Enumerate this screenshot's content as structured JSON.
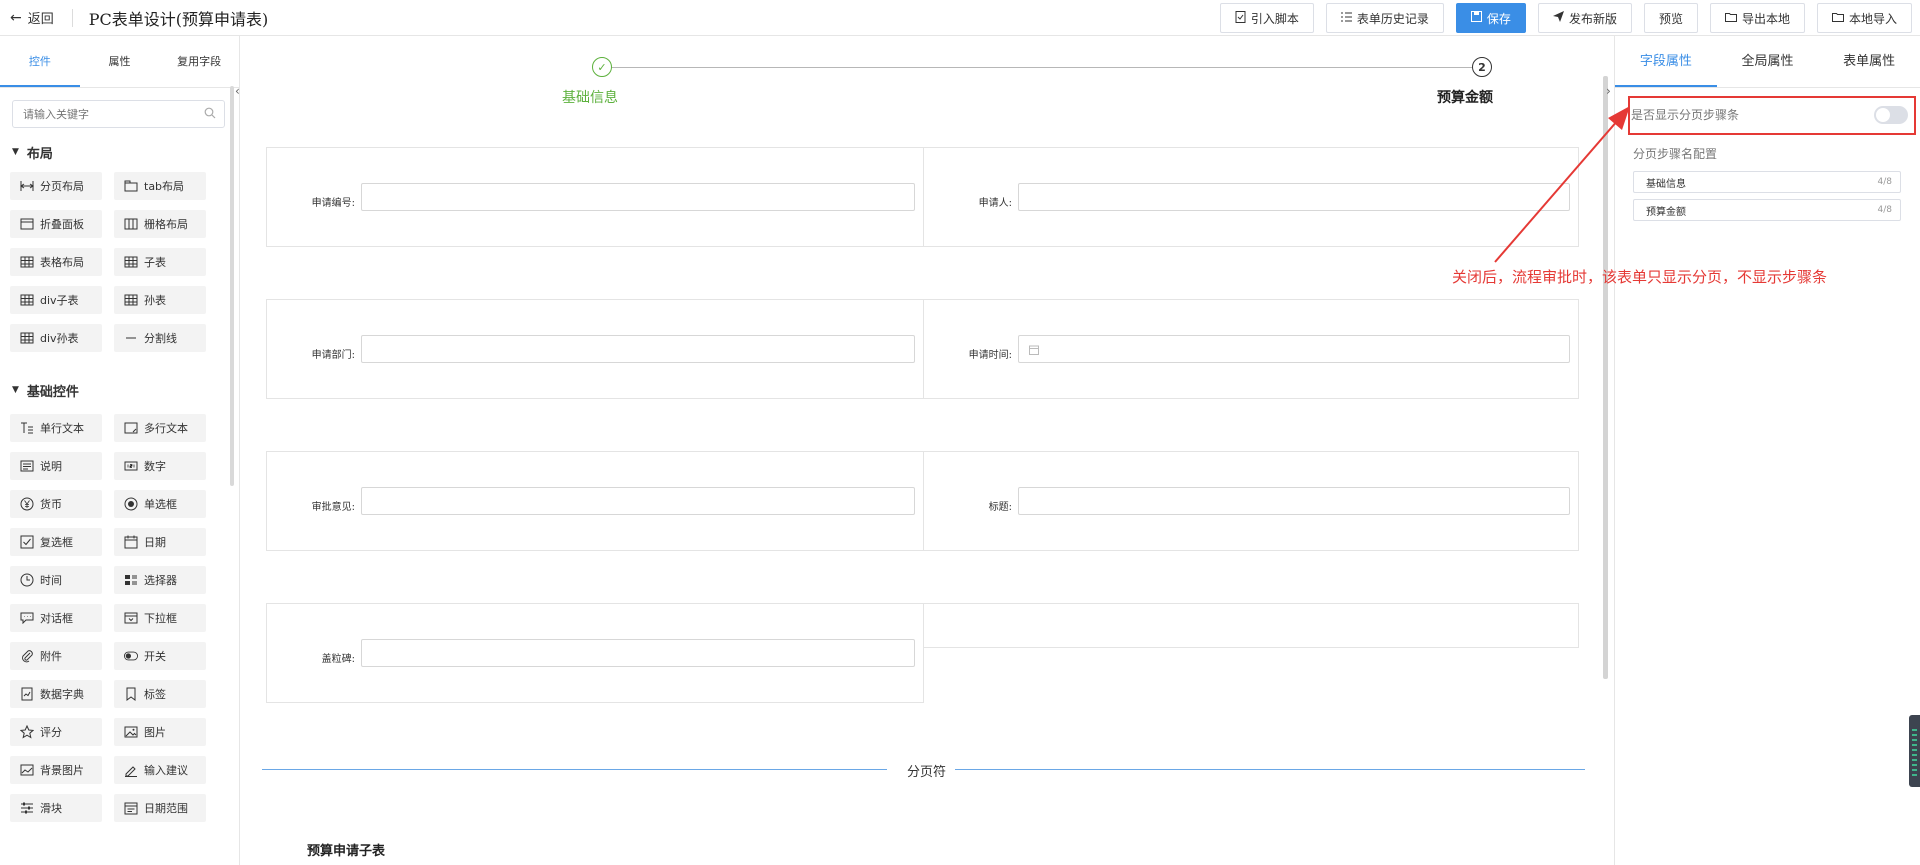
{
  "header": {
    "back_label": "返回",
    "title": "PC表单设计(预算申请表)",
    "buttons": {
      "import_script": "引入脚本",
      "history": "表单历史记录",
      "save": "保存",
      "publish": "发布新版",
      "preview": "预览",
      "export": "导出本地",
      "import_local": "本地导入"
    }
  },
  "left_panel": {
    "tabs": [
      "控件",
      "属性",
      "复用字段"
    ],
    "search_placeholder": "请输入关键字",
    "groups": [
      {
        "title": "布局",
        "items": [
          {
            "label": "分页布局",
            "icon": "page-layout-icon"
          },
          {
            "label": "tab布局",
            "icon": "tab-layout-icon"
          },
          {
            "label": "折叠面板",
            "icon": "collapse-panel-icon"
          },
          {
            "label": "栅格布局",
            "icon": "grid-layout-icon"
          },
          {
            "label": "表格布局",
            "icon": "table-layout-icon"
          },
          {
            "label": "子表",
            "icon": "subtable-icon"
          },
          {
            "label": "div子表",
            "icon": "div-subtable-icon"
          },
          {
            "label": "孙表",
            "icon": "grandchild-table-icon"
          },
          {
            "label": "div孙表",
            "icon": "div-grandchild-table-icon"
          },
          {
            "label": "分割线",
            "icon": "divider-icon"
          }
        ]
      },
      {
        "title": "基础控件",
        "items": [
          {
            "label": "单行文本",
            "icon": "single-text-icon"
          },
          {
            "label": "多行文本",
            "icon": "multi-text-icon"
          },
          {
            "label": "说明",
            "icon": "description-icon"
          },
          {
            "label": "数字",
            "icon": "number-icon"
          },
          {
            "label": "货币",
            "icon": "currency-icon"
          },
          {
            "label": "单选框",
            "icon": "radio-icon"
          },
          {
            "label": "复选框",
            "icon": "checkbox-icon"
          },
          {
            "label": "日期",
            "icon": "date-icon"
          },
          {
            "label": "时间",
            "icon": "time-icon"
          },
          {
            "label": "选择器",
            "icon": "selector-icon"
          },
          {
            "label": "对话框",
            "icon": "dialog-icon"
          },
          {
            "label": "下拉框",
            "icon": "dropdown-icon"
          },
          {
            "label": "附件",
            "icon": "attachment-icon"
          },
          {
            "label": "开关",
            "icon": "switch-icon"
          },
          {
            "label": "数据字典",
            "icon": "data-dictionary-icon"
          },
          {
            "label": "标签",
            "icon": "tag-icon"
          },
          {
            "label": "评分",
            "icon": "star-icon"
          },
          {
            "label": "图片",
            "icon": "image-icon"
          },
          {
            "label": "背景图片",
            "icon": "background-image-icon"
          },
          {
            "label": "输入建议",
            "icon": "input-suggest-icon"
          },
          {
            "label": "滑块",
            "icon": "slider-icon"
          },
          {
            "label": "日期范围",
            "icon": "date-range-icon"
          }
        ]
      }
    ]
  },
  "canvas": {
    "steps": [
      {
        "label": "基础信息",
        "marker": "✓",
        "state": "done"
      },
      {
        "label": "预算金额",
        "marker": "2",
        "state": "current"
      }
    ],
    "rows": [
      {
        "left": "申请编号:",
        "right": "申请人:"
      },
      {
        "left": "申请部门:",
        "right": "申请时间:"
      },
      {
        "left": "审批意见:",
        "right": "标题:"
      },
      {
        "left": "盖粒碑:",
        "right": ""
      }
    ],
    "page_break_label": "分页符",
    "subtable_title": "预算申请子表"
  },
  "right_panel": {
    "tabs": [
      "字段属性",
      "全局属性",
      "表单属性"
    ],
    "show_steps_label": "是否显示分页步骤条",
    "show_steps_value": false,
    "step_config_label": "分页步骤名配置",
    "step_names": [
      {
        "name": "基础信息",
        "count": "4/8"
      },
      {
        "name": "预算金额",
        "count": "4/8"
      }
    ]
  },
  "annotation": {
    "text": "关闭后，流程审批时，该表单只显示分页，不显示步骤条",
    "color": "#e53935"
  },
  "colors": {
    "primary": "#3a8ee6",
    "success": "#5db13d",
    "annotation": "#e53935"
  }
}
